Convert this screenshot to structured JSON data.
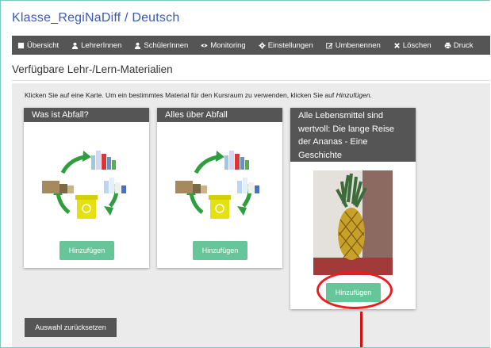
{
  "page": {
    "title": "Klasse_RegiNaDiff / Deutsch"
  },
  "navbar": {
    "items": [
      {
        "label": "Übersicht",
        "icon": "book-icon"
      },
      {
        "label": "LehrerInnen",
        "icon": "user-icon"
      },
      {
        "label": "SchülerInnen",
        "icon": "user-icon"
      },
      {
        "label": "Monitoring",
        "icon": "eye-icon"
      },
      {
        "label": "Einstellungen",
        "icon": "gear-icon"
      },
      {
        "label": "Umbenennen",
        "icon": "edit-icon"
      },
      {
        "label": "Löschen",
        "icon": "close-icon"
      },
      {
        "label": "Druck",
        "icon": "print-icon"
      }
    ]
  },
  "materials": {
    "heading": "Verfügbare Lehr-/Lern-Materialien",
    "hint_text": "Klicken Sie auf eine Karte. Um ein bestimmtes Material für den Kursraum zu verwenden, klicken Sie auf ",
    "hint_action": "Hinzufügen.",
    "cards": [
      {
        "title": "Was ist Abfall?",
        "button": "Hinzufügen"
      },
      {
        "title": "Alles über Abfall",
        "button": "Hinzufügen"
      },
      {
        "title": "Alle Lebensmittel sind wertvoll: Die lange Reise der Ananas - Eine Geschichte",
        "button": "Hinzufügen"
      }
    ],
    "reset_button": "Auswahl zurücksetzen"
  },
  "colors": {
    "title": "#3b5ab0",
    "navbar": "#555555",
    "add_button": "#66c599",
    "highlight": "#ee1c1c"
  }
}
